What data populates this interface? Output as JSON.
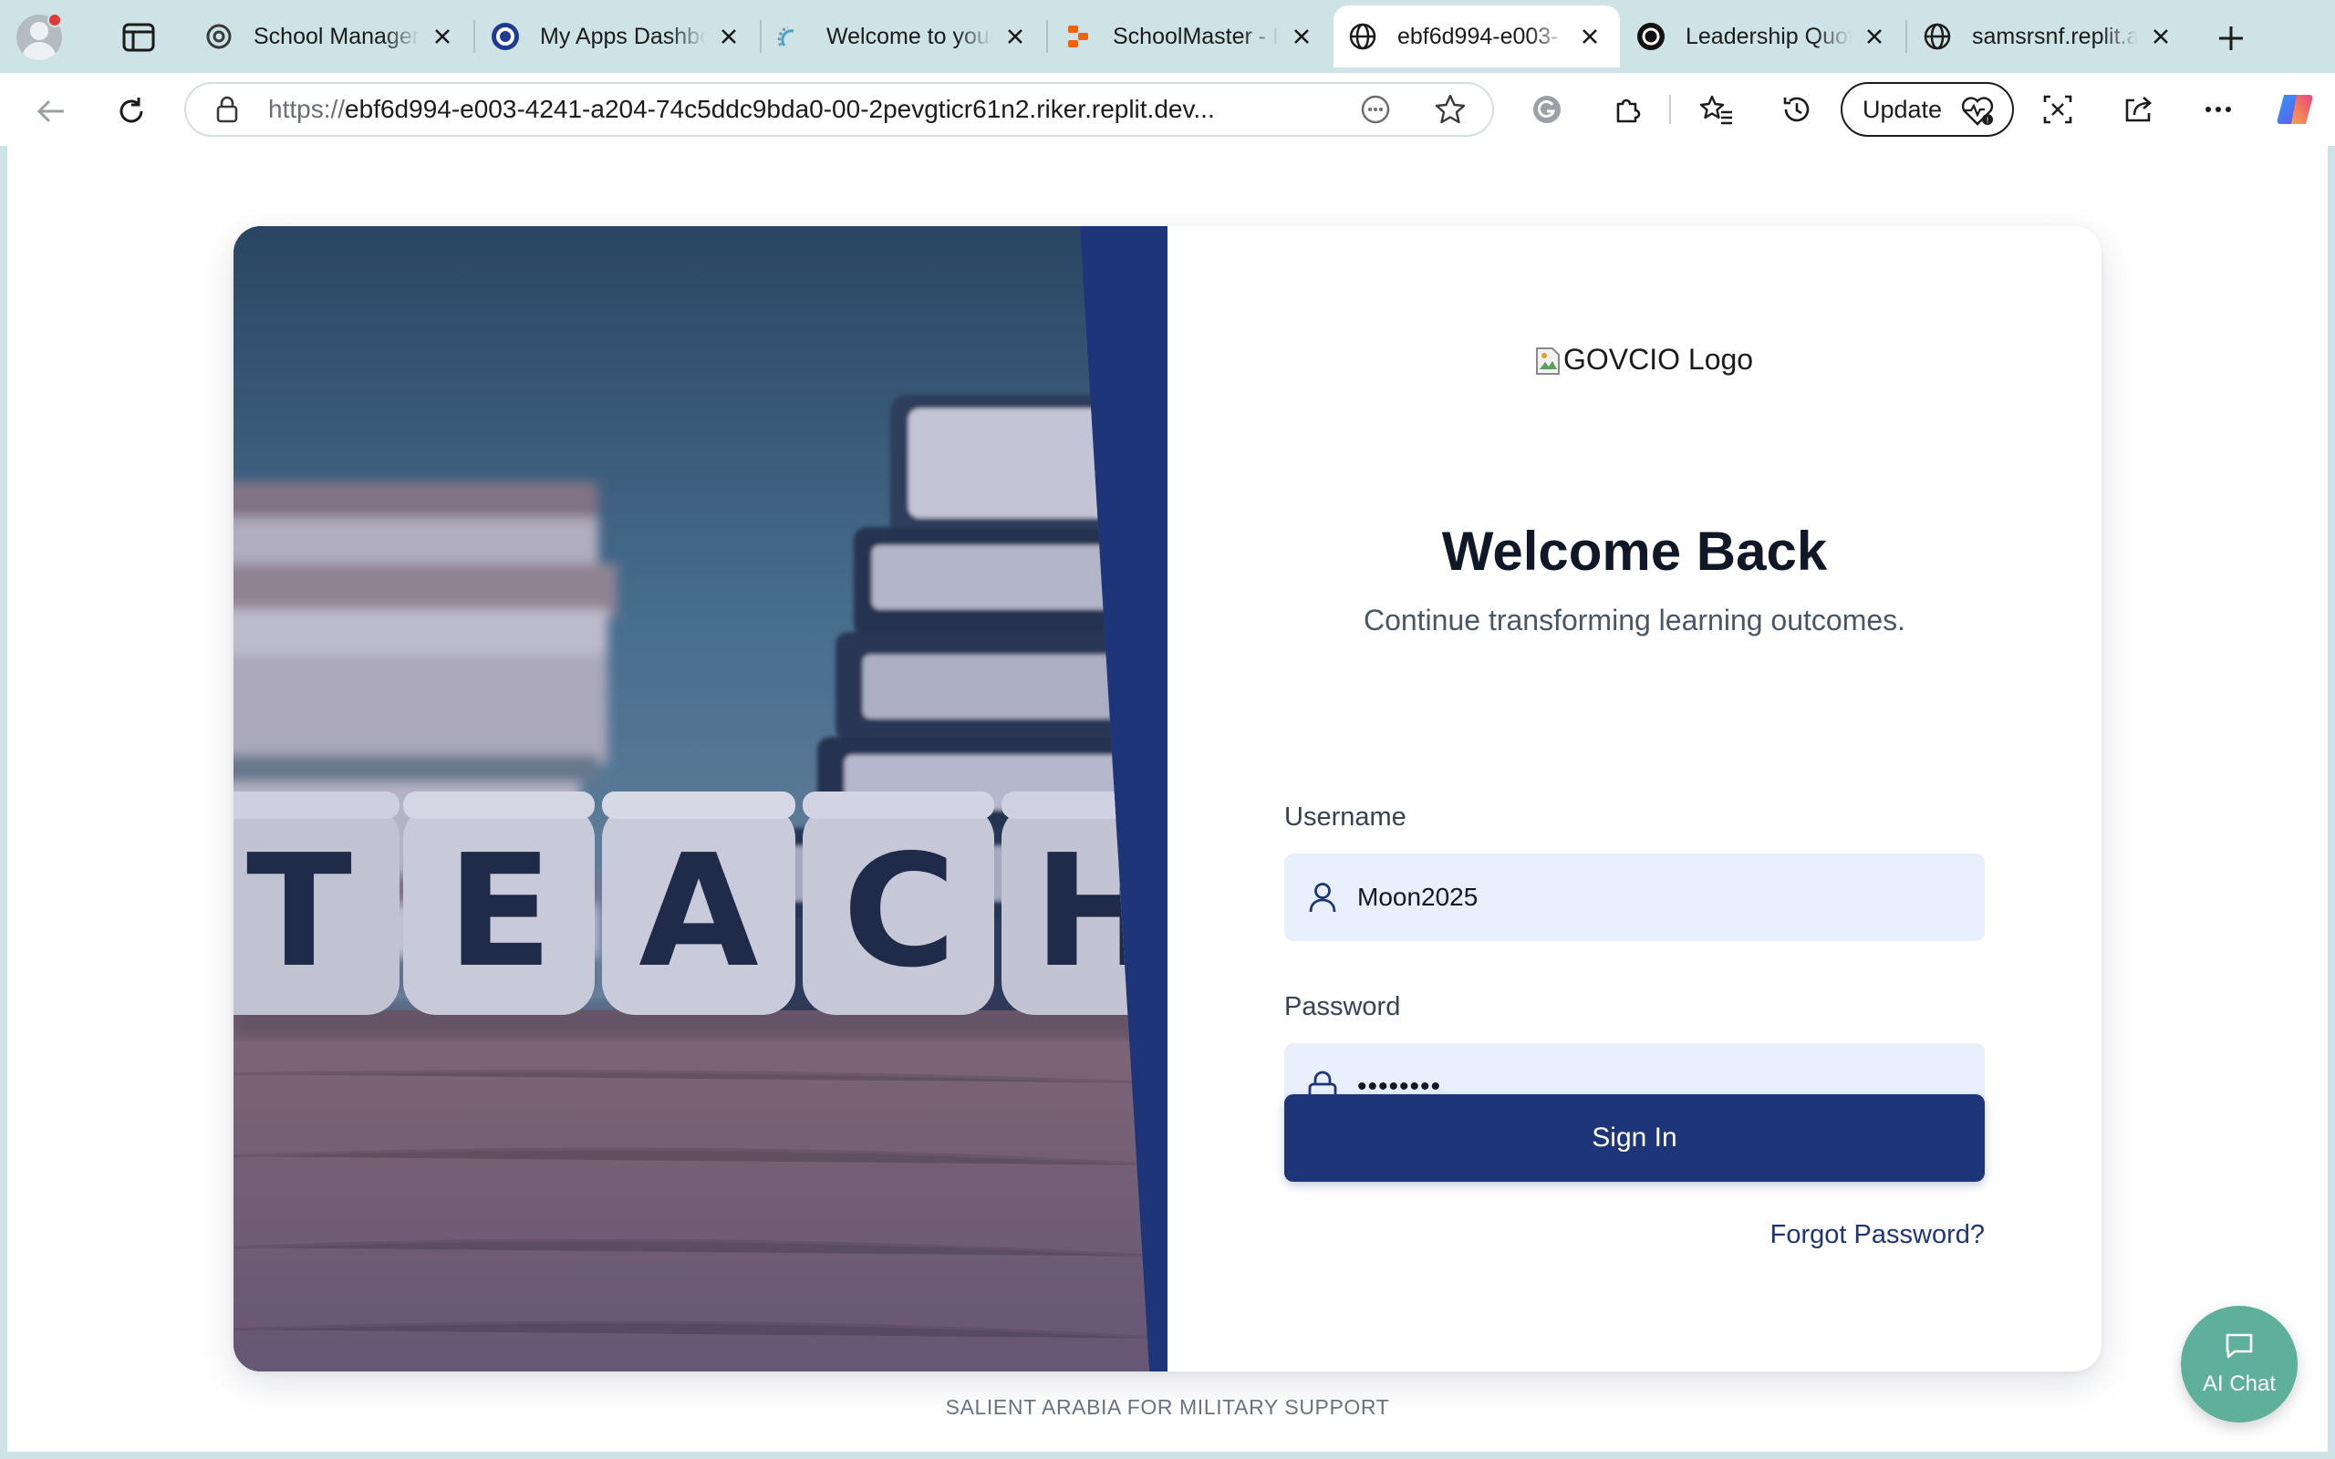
{
  "browser": {
    "tabs": [
      {
        "title": "School Managem",
        "favicon": "openai-icon"
      },
      {
        "title": "My Apps Dashbo",
        "favicon": "ring-icon"
      },
      {
        "title": "Welcome to your",
        "favicon": "loading-icon"
      },
      {
        "title": "SchoolMaster - R",
        "favicon": "replit-icon"
      },
      {
        "title": "ebf6d994-e003-",
        "favicon": "globe-icon",
        "active": true
      },
      {
        "title": "Leadership Quot",
        "favicon": "openai-icon"
      },
      {
        "title": "samsrsnf.replit.a",
        "favicon": "globe-icon"
      }
    ],
    "address": {
      "scheme": "https://",
      "host": "ebf6d994-e003-4241-a204-74c5ddc9bda0-00-2pevgticr61n2.riker.replit.dev..."
    },
    "update_label": "Update"
  },
  "page": {
    "logo_alt": "GOVCIO Logo",
    "hero_word": "TEACH",
    "title": "Welcome Back",
    "subtitle": "Continue transforming learning outcomes.",
    "username_label": "Username",
    "username_value": "Moon2025",
    "password_label": "Password",
    "password_value": "••••••••",
    "signin_label": "Sign In",
    "forgot_label": "Forgot Password?",
    "footer": "SALIENT ARABIA FOR MILITARY SUPPORT",
    "aichat_label": "AI Chat"
  },
  "colors": {
    "brand_navy": "#1e3679",
    "input_bg": "#e8f0fe",
    "chat_green": "#5fb09a",
    "chrome_bg": "#cde3e6"
  }
}
